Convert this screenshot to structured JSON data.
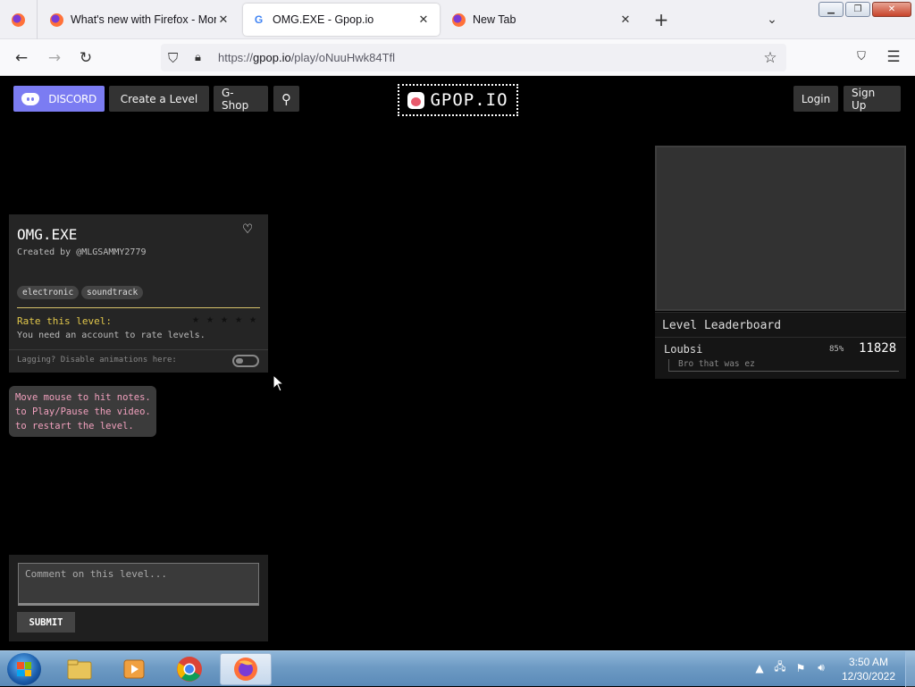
{
  "browser": {
    "tabs": [
      {
        "title": "What's new with Firefox - More",
        "icon": "firefox-icon",
        "active": false
      },
      {
        "title": "OMG.EXE - Gpop.io",
        "icon": "google-icon",
        "active": true
      },
      {
        "title": "New Tab",
        "icon": "firefox-icon",
        "active": false
      }
    ],
    "url_base": "https://",
    "url_host": "gpop.io",
    "url_path": "/play/oNuuHwk84Tfl"
  },
  "site": {
    "nav": {
      "discord": "DISCORD",
      "create": "Create a Level",
      "shop": "G-Shop",
      "logo": "GPOP.IO",
      "login": "Login",
      "signup": "Sign Up"
    },
    "level": {
      "title": "OMG.EXE",
      "creator": "Created by @MLGSAMMY2779",
      "tags": [
        "electronic",
        "soundtrack"
      ],
      "rate_label": "Rate this level:",
      "rate_note": "You need an account to rate levels.",
      "lag_label": "Lagging? Disable animations here:"
    },
    "hints": [
      "Move mouse to hit notes.",
      "to Play/Pause the video.",
      "to restart the level."
    ],
    "comment": {
      "placeholder": "Comment on this level...",
      "submit": "SUBMIT"
    },
    "leaderboard": {
      "title": "Level Leaderboard",
      "entries": [
        {
          "player": "Loubsi",
          "percent": "85%",
          "score": "11828",
          "comment": "Bro that was ez"
        }
      ]
    }
  },
  "taskbar": {
    "time": "3:50 AM",
    "date": "12/30/2022"
  },
  "colors": {
    "discord": "#7b7cf2",
    "rate_label": "#e0c64b",
    "hint_text": "#f0a0bd"
  }
}
